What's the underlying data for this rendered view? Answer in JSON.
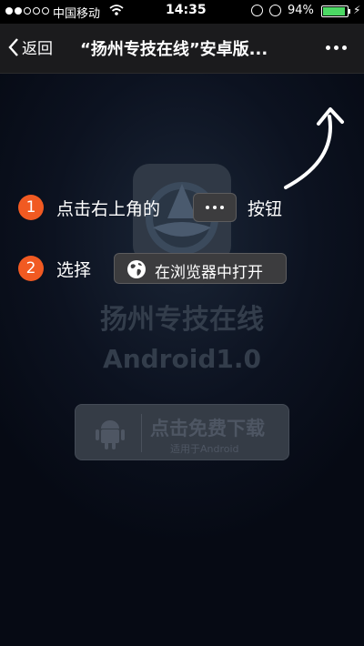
{
  "status_bar": {
    "carrier": "中国移动",
    "time": "14:35",
    "battery_percent": "94%",
    "battery_level": 0.94,
    "signal_bars_filled": 2,
    "signal_bars_total": 5
  },
  "nav": {
    "back_label": "返回",
    "title": "“扬州专技在线”安卓版..."
  },
  "app": {
    "name": "扬州专技在线",
    "version": "Android1.0",
    "download_label": "点击免费下载",
    "download_sub": "适用于Android"
  },
  "guide": {
    "step1_number": "1",
    "step1_prefix": "点击右上角的",
    "step1_suffix": "按钮",
    "step2_number": "2",
    "step2_prefix": "选择",
    "step2_button_label": "在浏览器中打开"
  },
  "colors": {
    "accent_orange": "#f15a22",
    "battery_green": "#4cd964",
    "nav_background": "#1b1b1d"
  },
  "icons": [
    "wifi-icon",
    "rotation-lock-icon",
    "alarm-icon",
    "battery-icon",
    "charging-icon",
    "back-chevron-icon",
    "more-dots-icon",
    "globe-icon",
    "android-icon",
    "curved-arrow-icon"
  ]
}
